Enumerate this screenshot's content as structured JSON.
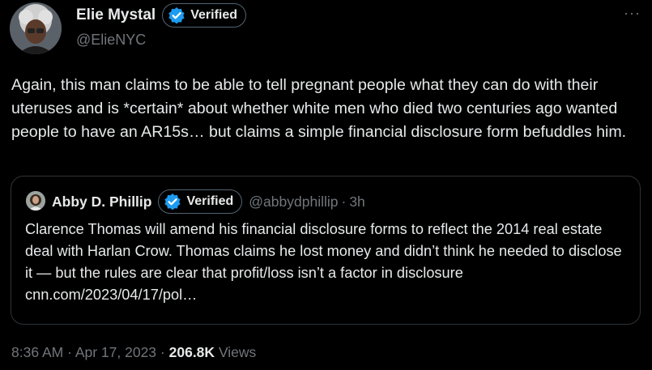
{
  "author": {
    "display_name": "Elie Mystal",
    "verified_label": "Verified",
    "handle": "@ElieNYC"
  },
  "more_label": "···",
  "tweet": {
    "text": "Again, this man claims to be able to tell pregnant people what they can do with their uteruses and is *certain* about whether white men who died two centuries ago wanted people to have an AR15s… but claims a simple financial disclosure form befuddles him."
  },
  "quote": {
    "display_name": "Abby D. Phillip",
    "verified_label": "Verified",
    "handle": "@abbydphillip",
    "separator": "·",
    "time": "3h",
    "text": "Clarence Thomas will amend his financial disclosure forms to reflect the 2014 real estate deal with Harlan Crow. Thomas claims he lost money and didn’t think he needed to disclose it — but the rules are clear that profit/loss isn’t a factor in disclosure cnn.com/2023/04/17/pol…"
  },
  "meta": {
    "time": "8:36 AM",
    "sep1": "·",
    "date": "Apr 17, 2023",
    "sep2": "·",
    "views_count": "206.8K",
    "views_label": "Views"
  },
  "colors": {
    "background": "#000000",
    "text_primary": "#e7e9ea",
    "text_secondary": "#71767b",
    "verified_blue": "#1d9bf0",
    "border": "#2f3336"
  }
}
